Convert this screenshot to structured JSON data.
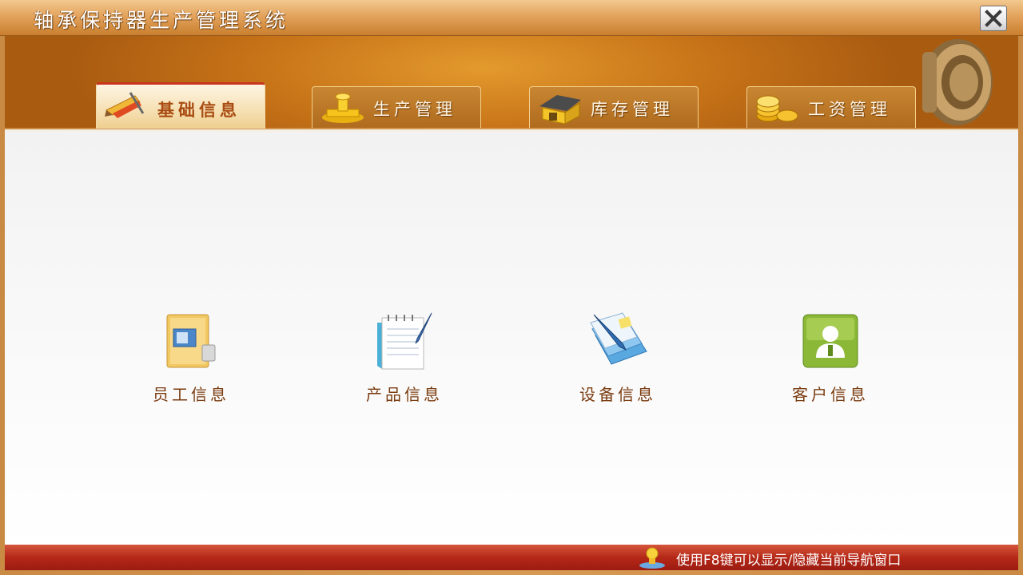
{
  "window": {
    "title": "轴承保持器生产管理系统"
  },
  "tabs": [
    {
      "label": "基础信息",
      "icon": "pencil-ruler-icon",
      "active": true
    },
    {
      "label": "生产管理",
      "icon": "stamp-icon",
      "active": false
    },
    {
      "label": "库存管理",
      "icon": "warehouse-icon",
      "active": false
    },
    {
      "label": "工资管理",
      "icon": "coins-icon",
      "active": false
    }
  ],
  "items": [
    {
      "label": "员工信息",
      "icon": "employee-folder-icon"
    },
    {
      "label": "产品信息",
      "icon": "notepad-pen-icon"
    },
    {
      "label": "设备信息",
      "icon": "documents-pen-icon"
    },
    {
      "label": "客户信息",
      "icon": "customer-avatar-icon"
    }
  ],
  "status": {
    "text": "使用F8键可以显示/隐藏当前导航窗口",
    "icon": "bulb-user-icon"
  },
  "colors": {
    "header": "#c77318",
    "active_tab_accent": "#c9341f",
    "label_text": "#7b3c10",
    "statusbar": "#b52818"
  }
}
